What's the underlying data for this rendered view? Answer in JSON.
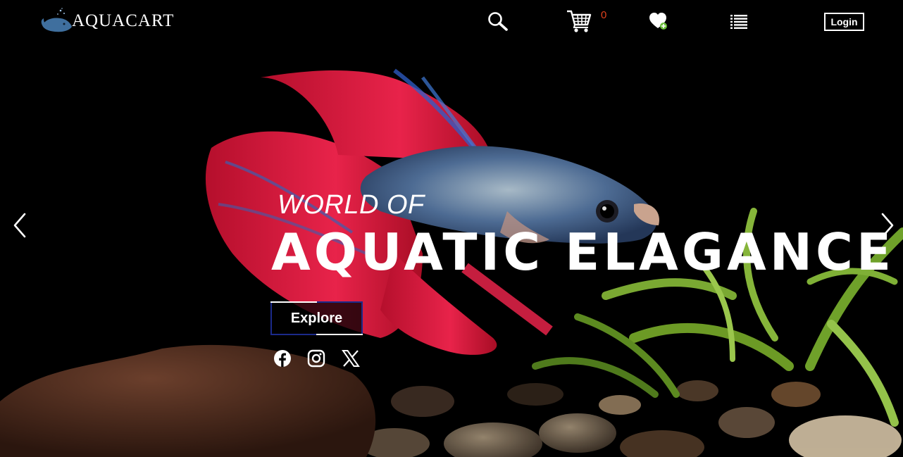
{
  "header": {
    "logo_text": "AQUACART",
    "cart_count": "0",
    "login_label": "Login",
    "icons": [
      "search-icon",
      "cart-icon",
      "wishlist-heart-icon",
      "menu-list-icon"
    ]
  },
  "hero": {
    "subtitle": "WORLD OF",
    "title": "AQUATIC ELAGANCE",
    "cta_label": "Explore",
    "social_icons": [
      "facebook-icon",
      "instagram-icon",
      "x-icon"
    ],
    "nav_icons": [
      "chevron-left-icon",
      "chevron-right-icon"
    ]
  },
  "colors": {
    "background": "#000000",
    "text": "#ffffff",
    "cart_count": "#e0401c",
    "explore_border": "#1b2a8a",
    "logo_whale": "#3f6f9e"
  }
}
